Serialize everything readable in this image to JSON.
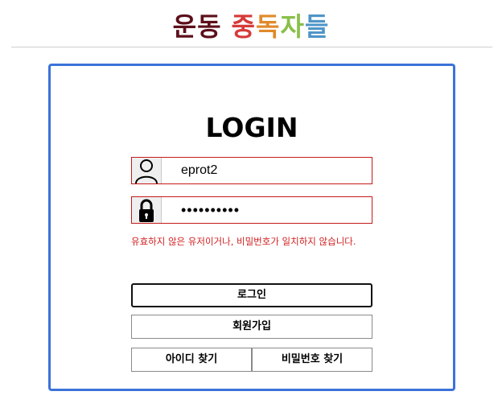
{
  "brand": {
    "chars": [
      {
        "text": "운",
        "color": "#5c0f1a"
      },
      {
        "text": "동",
        "color": "#5c0f1a"
      },
      {
        "text": " ",
        "color": "#000000"
      },
      {
        "text": "중",
        "color": "#d63a3a"
      },
      {
        "text": "독",
        "color": "#e08a2a"
      },
      {
        "text": "자",
        "color": "#8bbf4a"
      },
      {
        "text": "들",
        "color": "#4f95c7"
      }
    ]
  },
  "card": {
    "title": "LOGIN",
    "username": {
      "value": "eprot2",
      "icon": "user-icon"
    },
    "password": {
      "value": "••••••••••",
      "icon": "lock-icon"
    },
    "error": "유효하지 않은 유저이거나, 비밀번호가 일치하지 않습니다.",
    "buttons": {
      "login": "로그인",
      "signup": "회원가입",
      "find_id": "아이디 찾기",
      "find_pw": "비밀번호 찾기"
    }
  },
  "colors": {
    "card_border": "#3b73d9",
    "field_border": "#c41b1b",
    "error": "#d12020"
  }
}
